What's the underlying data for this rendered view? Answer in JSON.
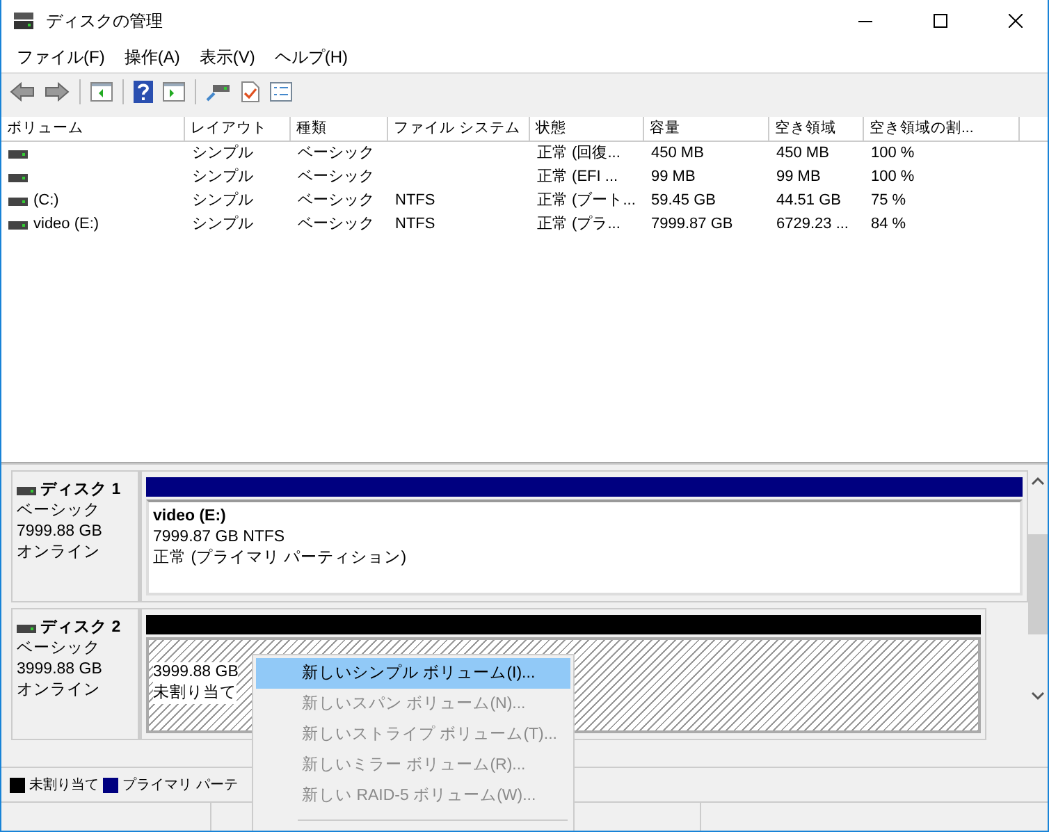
{
  "window": {
    "title": "ディスクの管理"
  },
  "menu_bar": [
    "ファイル(F)",
    "操作(A)",
    "表示(V)",
    "ヘルプ(H)"
  ],
  "table": {
    "columns": [
      "ボリューム",
      "レイアウト",
      "種類",
      "ファイル システム",
      "状態",
      "容量",
      "空き領域",
      "空き領域の割..."
    ],
    "rows": [
      [
        "",
        "シンプル",
        "ベーシック",
        "",
        "正常 (回復...",
        "450 MB",
        "450 MB",
        "100 %"
      ],
      [
        "",
        "シンプル",
        "ベーシック",
        "",
        "正常 (EFI ...",
        "99 MB",
        "99 MB",
        "100 %"
      ],
      [
        "(C:)",
        "シンプル",
        "ベーシック",
        "NTFS",
        "正常 (ブート...",
        "59.45 GB",
        "44.51 GB",
        "75 %"
      ],
      [
        "video (E:)",
        "シンプル",
        "ベーシック",
        "NTFS",
        "正常 (プラ...",
        "7999.87 GB",
        "6729.23 ...",
        "84 %"
      ]
    ]
  },
  "disks": [
    {
      "name": "ディスク 1",
      "type": "ベーシック",
      "size": "7999.88 GB",
      "status": "オンライン",
      "partition": {
        "kind": "primary",
        "title": "video  (E:)",
        "lines": [
          "7999.87 GB NTFS",
          "正常 (プライマリ パーティション)"
        ]
      }
    },
    {
      "name": "ディスク 2",
      "type": "ベーシック",
      "size": "3999.88 GB",
      "status": "オンライン",
      "partition": {
        "kind": "unallocated",
        "lines": [
          "3999.88 GB",
          "未割り当て"
        ]
      }
    }
  ],
  "legend": [
    {
      "label": "未割り当て",
      "color": "#000000"
    },
    {
      "label": "プライマリ パーテ",
      "color": "#000080"
    }
  ],
  "context_menu": [
    {
      "label": "新しいシンプル ボリューム(I)...",
      "selected": true,
      "disabled": false
    },
    {
      "label": "新しいスパン ボリューム(N)...",
      "selected": false,
      "disabled": true
    },
    {
      "label": "新しいストライプ ボリューム(T)...",
      "selected": false,
      "disabled": true
    },
    {
      "label": "新しいミラー ボリューム(R)...",
      "selected": false,
      "disabled": true
    },
    {
      "label": "新しい RAID-5 ボリューム(W)...",
      "selected": false,
      "disabled": true
    }
  ]
}
